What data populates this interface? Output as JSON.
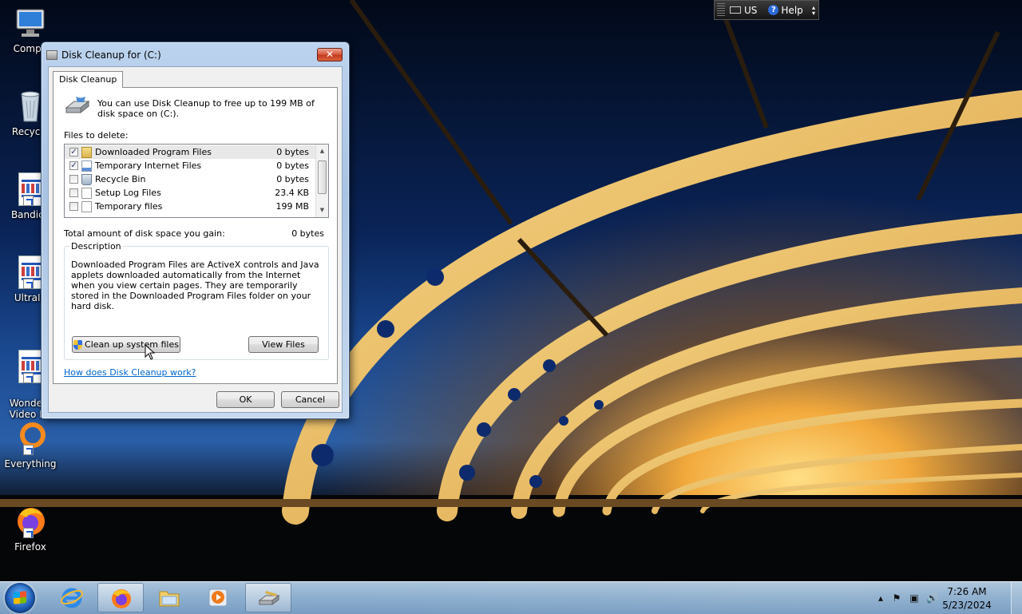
{
  "desktop": {
    "icons": [
      {
        "label": "Compu",
        "icon": "computer-icon"
      },
      {
        "label": "Recycle",
        "icon": "recycle-bin-icon"
      },
      {
        "label": "Bandica",
        "icon": "bandicam-shortcut-icon"
      },
      {
        "label": "UltraIS",
        "icon": "ultraiso-shortcut-icon"
      },
      {
        "label": "Wonders\nVideo Ed",
        "icon": "wondershare-shortcut-icon"
      },
      {
        "label": "Everything",
        "icon": "everything-shortcut-icon"
      },
      {
        "label": "Firefox",
        "icon": "firefox-shortcut-icon"
      }
    ]
  },
  "langbar": {
    "language": "US",
    "help": "Help"
  },
  "dialog": {
    "title": "Disk Cleanup for  (C:)",
    "close_glyph": "✕",
    "tab": "Disk Cleanup",
    "intro": "You can use Disk Cleanup to free up to 199 MB of disk space on  (C:).",
    "files_label": "Files to delete:",
    "files": [
      {
        "name": "Downloaded Program Files",
        "size": "0 bytes",
        "checked": true,
        "selected": true
      },
      {
        "name": "Temporary Internet Files",
        "size": "0 bytes",
        "checked": true,
        "selected": false
      },
      {
        "name": "Recycle Bin",
        "size": "0 bytes",
        "checked": false,
        "selected": false
      },
      {
        "name": "Setup Log Files",
        "size": "23.4 KB",
        "checked": false,
        "selected": false
      },
      {
        "name": "Temporary files",
        "size": "199 MB",
        "checked": false,
        "selected": false
      }
    ],
    "total_label": "Total amount of disk space you gain:",
    "total_value": "0 bytes",
    "description_legend": "Description",
    "description": "Downloaded Program Files are ActiveX controls and Java applets downloaded automatically from the Internet when you view certain pages. They are temporarily stored in the Downloaded Program Files folder on your hard disk.",
    "cleanup_button": "Clean up system files",
    "view_files_button": "View Files",
    "help_link": "How does Disk Cleanup work?",
    "ok_button": "OK",
    "cancel_button": "Cancel"
  },
  "taskbar": {
    "apps": [
      "internet-explorer-icon",
      "firefox-icon",
      "windows-explorer-icon",
      "media-player-icon",
      "disk-cleanup-icon"
    ],
    "active_apps": [
      "firefox-icon",
      "disk-cleanup-icon"
    ],
    "time": "7:26 AM",
    "date": "5/23/2024"
  },
  "colors": {
    "link": "#0066cc",
    "close_button": "#c43b1e",
    "taskbar": "#9bbce0"
  }
}
